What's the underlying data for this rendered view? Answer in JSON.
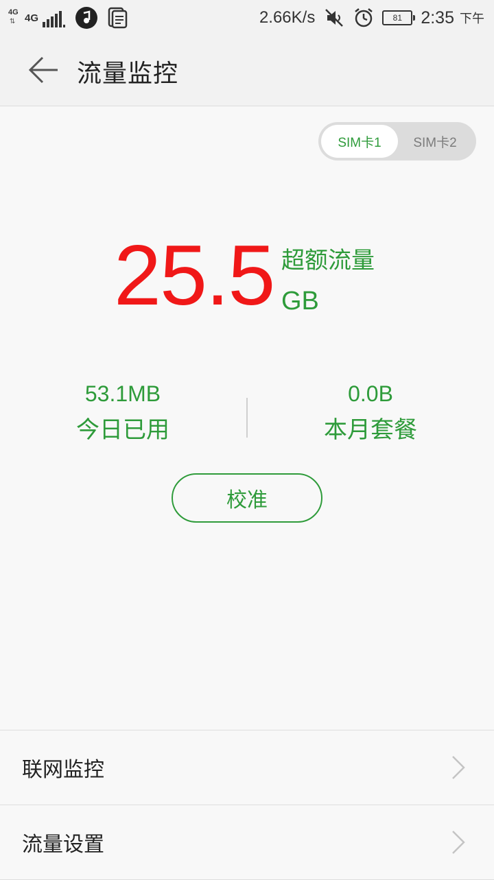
{
  "status_bar": {
    "network_small": "4G",
    "network": "4G",
    "net_speed": "2.66K/s",
    "battery": "81",
    "time": "2:35",
    "ampm": "下午",
    "icons": [
      "signal-icon",
      "music-app-icon",
      "document-icon",
      "mute-icon",
      "alarm-icon",
      "battery-icon"
    ]
  },
  "header": {
    "title": "流量监控",
    "back_icon": "back-arrow-icon"
  },
  "sim_toggle": {
    "sim1": "SIM卡1",
    "sim2": "SIM卡2",
    "selected": "SIM卡1"
  },
  "usage": {
    "amount": "25.5",
    "status": "超额流量",
    "unit": "GB"
  },
  "stats": {
    "today_value": "53.1MB",
    "today_label": "今日已用",
    "plan_value": "0.0B",
    "plan_label": "本月套餐"
  },
  "calibrate_label": "校准",
  "menu": [
    {
      "label": "联网监控",
      "icon": "chevron-right-icon"
    },
    {
      "label": "流量设置",
      "icon": "chevron-right-icon"
    }
  ],
  "colors": {
    "accent_green": "#2e9b3a",
    "over_red": "#f01818",
    "background": "#f8f8f8"
  }
}
